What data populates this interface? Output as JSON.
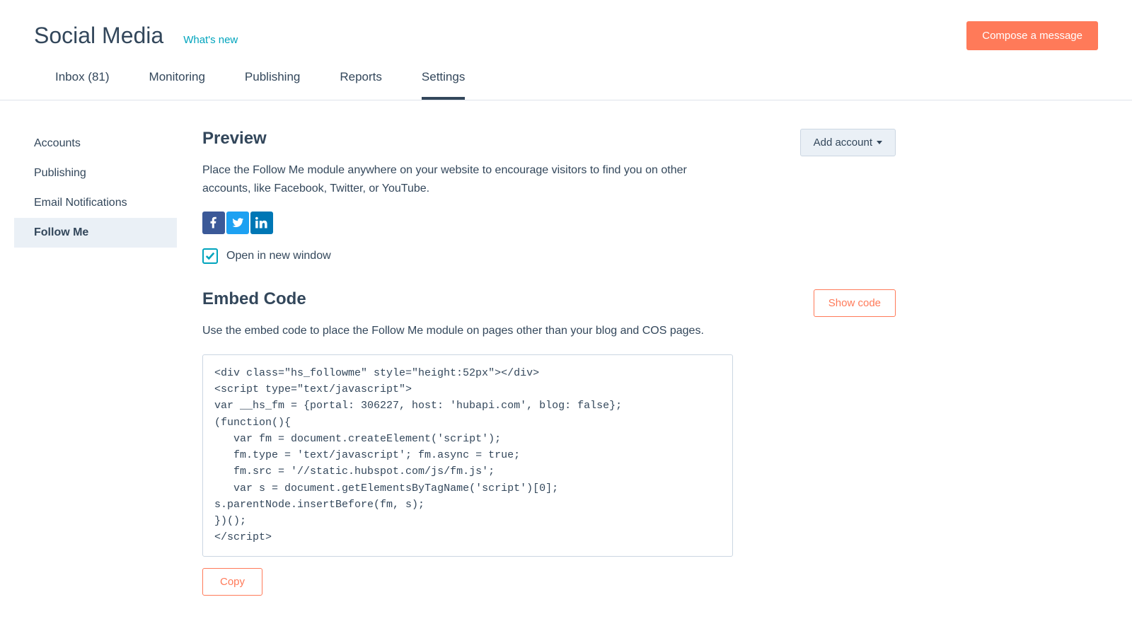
{
  "header": {
    "title": "Social Media",
    "whats_new": "What's new",
    "compose": "Compose a message"
  },
  "tabs": [
    {
      "label": "Inbox (81)"
    },
    {
      "label": "Monitoring"
    },
    {
      "label": "Publishing"
    },
    {
      "label": "Reports"
    },
    {
      "label": "Settings"
    }
  ],
  "sidebar": [
    {
      "label": "Accounts"
    },
    {
      "label": "Publishing"
    },
    {
      "label": "Email Notifications"
    },
    {
      "label": "Follow Me"
    }
  ],
  "preview": {
    "heading": "Preview",
    "description": "Place the Follow Me module anywhere on your website to encourage visitors to find you on other accounts, like Facebook, Twitter, or YouTube.",
    "add_account": "Add account",
    "checkbox_label": "Open in new window"
  },
  "embed": {
    "heading": "Embed Code",
    "description": "Use the embed code to place the Follow Me module on pages other than your blog and COS pages.",
    "show_code": "Show code",
    "code": "<div class=\"hs_followme\" style=\"height:52px\"></div>\n<script type=\"text/javascript\">\nvar __hs_fm = {portal: 306227, host: 'hubapi.com', blog: false};\n(function(){\n   var fm = document.createElement('script');\n   fm.type = 'text/javascript'; fm.async = true;\n   fm.src = '//static.hubspot.com/js/fm.js';\n   var s = document.getElementsByTagName('script')[0]; s.parentNode.insertBefore(fm, s);\n})();\n</script>",
    "copy": "Copy"
  }
}
